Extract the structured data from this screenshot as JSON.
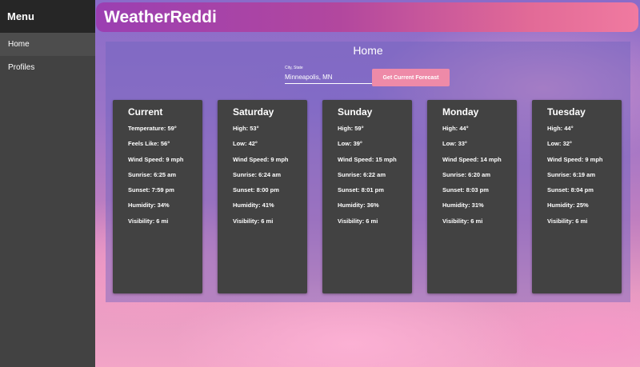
{
  "sidebar": {
    "title": "Menu",
    "items": [
      {
        "label": "Home",
        "active": true
      },
      {
        "label": "Profiles",
        "active": false
      }
    ]
  },
  "appbar": {
    "title": "WeatherReddi"
  },
  "page": {
    "title": "Home",
    "search": {
      "label": "City, State",
      "value": "Minneapolis, MN",
      "button_label": "Get Current Forecast"
    }
  },
  "cards": [
    {
      "title": "Current",
      "rows": [
        "Temperature: 59°",
        "Feels Like: 56°",
        "Wind Speed: 9 mph",
        "Sunrise: 6:25 am",
        "Sunset: 7:59 pm",
        "Humidity: 34%",
        "Visibility: 6 mi"
      ]
    },
    {
      "title": "Saturday",
      "rows": [
        "High: 53°",
        "Low: 42°",
        "Wind Speed: 9 mph",
        "Sunrise: 6:24 am",
        "Sunset: 8:00 pm",
        "Humidity: 41%",
        "Visibility: 6 mi"
      ]
    },
    {
      "title": "Sunday",
      "rows": [
        "High: 59°",
        "Low: 39°",
        "Wind Speed: 15 mph",
        "Sunrise: 6:22 am",
        "Sunset: 8:01 pm",
        "Humidity: 36%",
        "Visibility: 6 mi"
      ]
    },
    {
      "title": "Monday",
      "rows": [
        "High: 44°",
        "Low: 33°",
        "Wind Speed: 14 mph",
        "Sunrise: 6:20 am",
        "Sunset: 8:03 pm",
        "Humidity: 31%",
        "Visibility: 6 mi"
      ]
    },
    {
      "title": "Tuesday",
      "rows": [
        "High: 44°",
        "Low: 32°",
        "Wind Speed: 9 mph",
        "Sunrise: 6:19 am",
        "Sunset: 8:04 pm",
        "Humidity: 25%",
        "Visibility: 6 mi"
      ]
    }
  ],
  "colors": {
    "sidebar_bg": "#424242",
    "sidebar_header_bg": "#262626",
    "card_bg": "#424242",
    "button_bg": "#ee8aa8",
    "appbar_gradient_start": "#9b3fb2",
    "appbar_gradient_end": "#f07aa0"
  }
}
